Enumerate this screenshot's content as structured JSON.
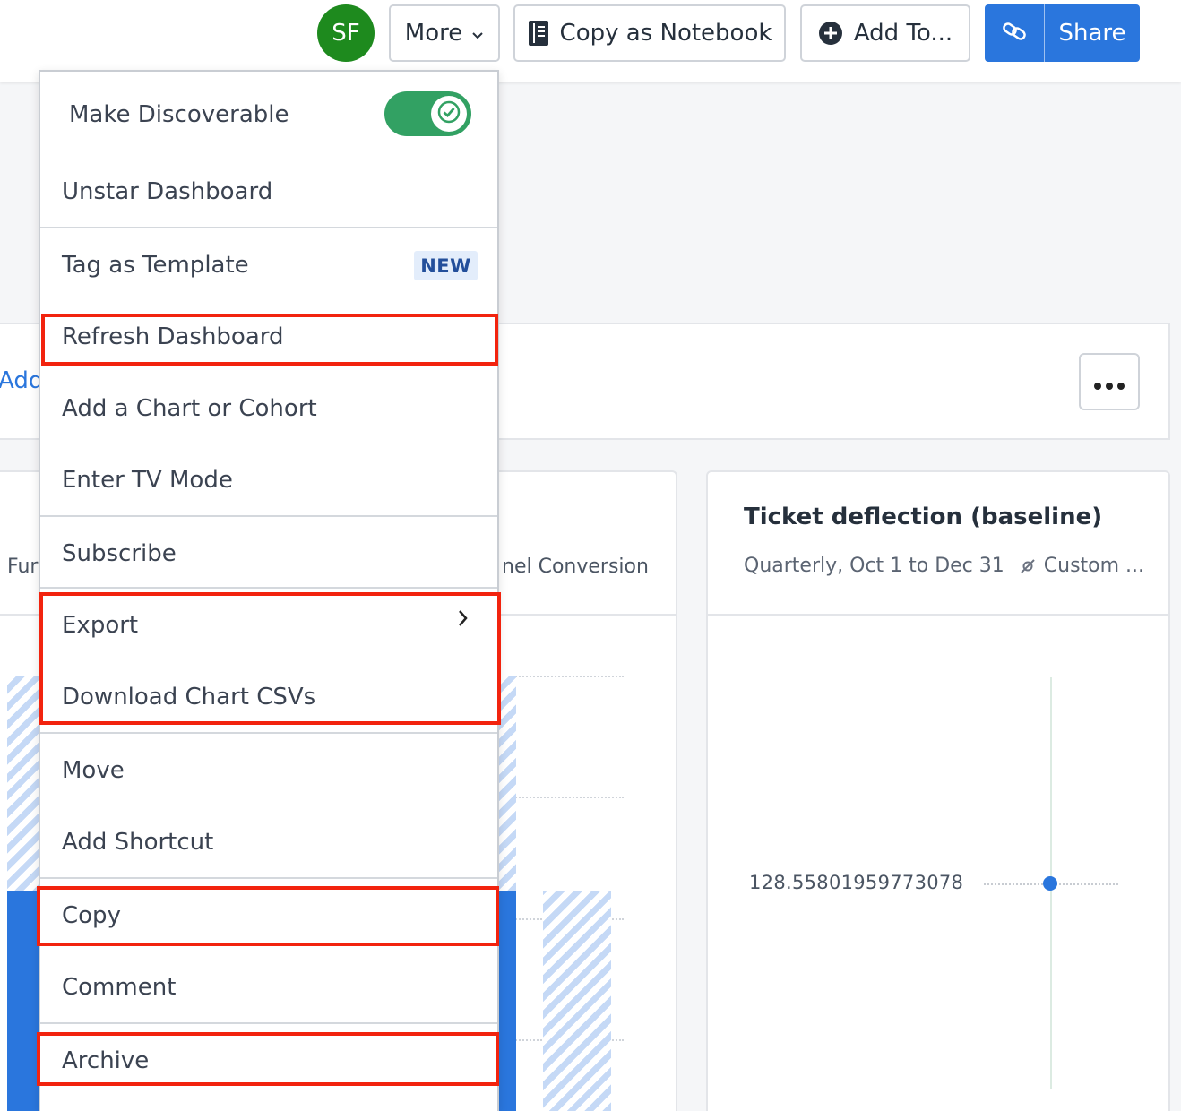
{
  "header": {
    "avatar_initials": "SF",
    "more_label": "More",
    "copy_notebook_label": "Copy as Notebook",
    "add_to_label": "Add To...",
    "share_label": "Share"
  },
  "menu": {
    "make_discoverable": {
      "label": "Make Discoverable",
      "toggle_on": true
    },
    "unstar": "Unstar Dashboard",
    "tag_template": "Tag as Template",
    "new_badge": "NEW",
    "refresh": "Refresh Dashboard",
    "add_chart": "Add a Chart or Cohort",
    "tv_mode": "Enter TV Mode",
    "subscribe": "Subscribe",
    "export": "Export",
    "download_csv": "Download Chart CSVs",
    "move": "Move",
    "add_shortcut": "Add Shortcut",
    "copy": "Copy",
    "comment": "Comment",
    "archive": "Archive"
  },
  "dashboard": {
    "add_link": "Add",
    "left_card": {
      "label_fragment_left": "Fur",
      "label_fragment_right": "nel Conversion"
    },
    "right_card": {
      "title": "Ticket deflection (baseline)",
      "subtitle": "Quarterly, Oct 1 to Dec 31",
      "segment": "Custom ...",
      "value": "128.55801959773078"
    }
  },
  "colors": {
    "accent": "#2a76dd",
    "toggle_green": "#32a163",
    "avatar_green": "#1e8a1e",
    "highlight_red": "#f2230e"
  }
}
